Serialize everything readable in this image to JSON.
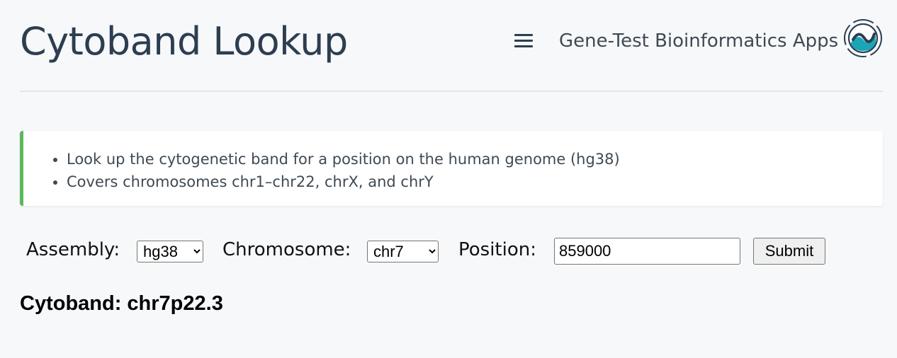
{
  "header": {
    "title": "Cytoband Lookup",
    "menu_icon": "hamburger-menu-icon",
    "brand_link": "Gene-Test Bioinformatics Apps",
    "logo_icon": "gene-test-logo",
    "colors": {
      "title": "#2c3e50",
      "logo_teal": "#1aa6b7",
      "logo_dark": "#2c3e50"
    }
  },
  "info": {
    "accent_color": "#5cb85c",
    "items": [
      "Look up the cytogenetic band for a position on the human genome (hg38)",
      "Covers chromosomes chr1–chr22, chrX, and chrY"
    ]
  },
  "form": {
    "assembly_label": "Assembly:",
    "assembly_value": "hg38",
    "chromosome_label": "Chromosome:",
    "chromosome_value": "chr7",
    "position_label": "Position:",
    "position_value": "859000",
    "submit_label": "Submit"
  },
  "result": {
    "text": "Cytoband: chr7p22.3"
  }
}
